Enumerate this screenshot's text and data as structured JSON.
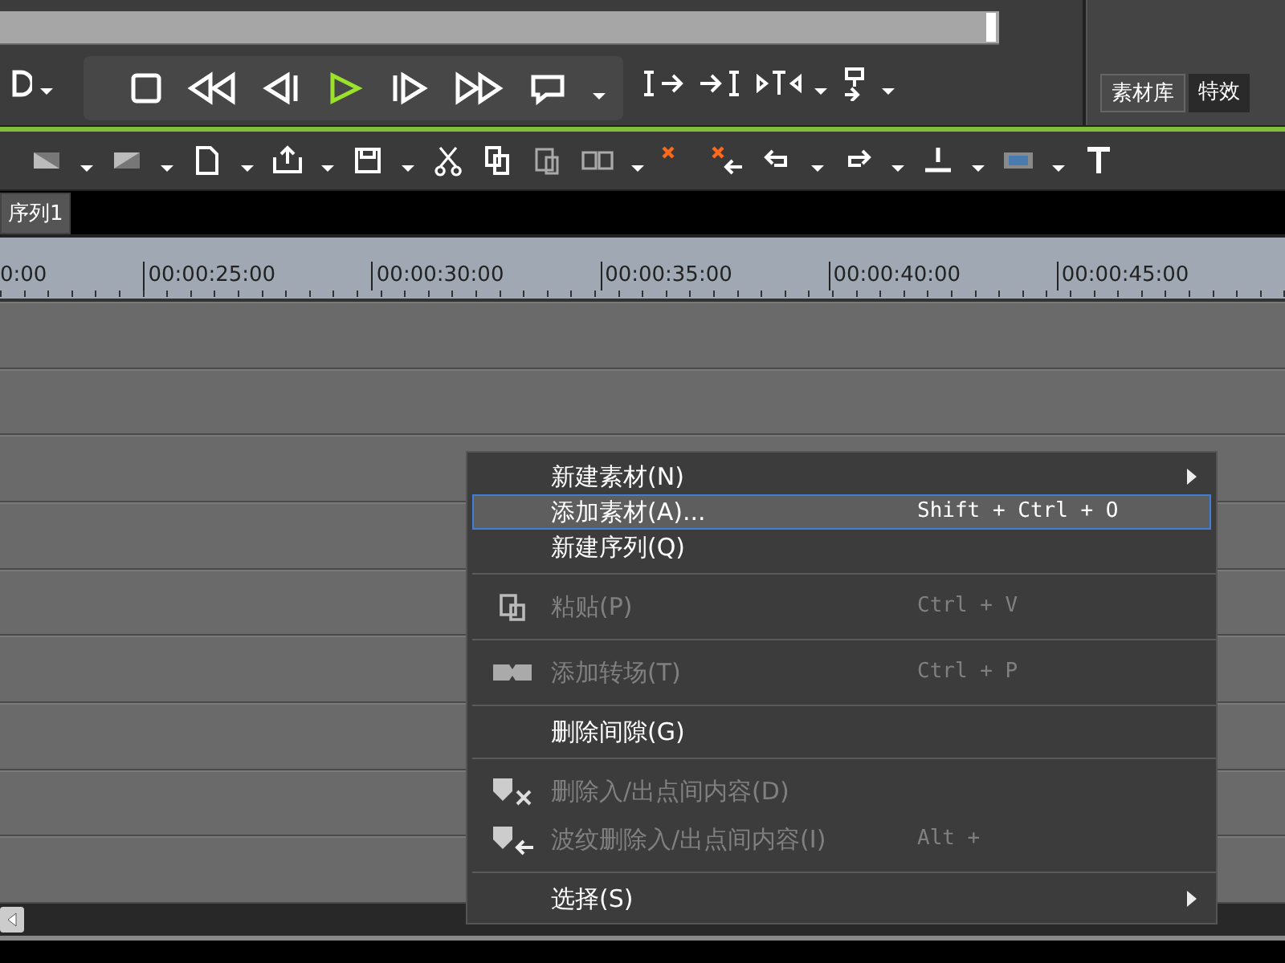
{
  "library_tabs": [
    {
      "label": "素材库",
      "selected": true
    },
    {
      "label": "特效",
      "selected": false
    }
  ],
  "sequence_tab": {
    "label": "序列1",
    "selected": true
  },
  "ruler": {
    "labels": [
      "0:00",
      "00:00:25:00",
      "00:00:30:00",
      "00:00:35:00",
      "00:00:40:00",
      "00:00:45:00"
    ]
  },
  "context_menu": {
    "items": [
      {
        "kind": "item",
        "label": "新建素材(N)",
        "submenu": true,
        "disabled": false,
        "selected": false
      },
      {
        "kind": "item",
        "label": "添加素材(A)...",
        "shortcut": "Shift + Ctrl + O",
        "submenu": false,
        "disabled": false,
        "selected": true
      },
      {
        "kind": "item",
        "label": "新建序列(Q)",
        "submenu": false,
        "disabled": false,
        "selected": false
      },
      {
        "kind": "separator"
      },
      {
        "kind": "paste",
        "label": "粘贴(P)",
        "shortcut": "Ctrl + V",
        "submenu": false,
        "disabled": true,
        "selected": false
      },
      {
        "kind": "separator"
      },
      {
        "kind": "transition",
        "label": "添加转场(T)",
        "shortcut": "Ctrl + P",
        "submenu": false,
        "disabled": true,
        "selected": false
      },
      {
        "kind": "separator"
      },
      {
        "kind": "item",
        "label": "删除间隙(G)",
        "submenu": false,
        "disabled": false,
        "selected": false
      },
      {
        "kind": "separator"
      },
      {
        "kind": "delete",
        "label": "删除入/出点间内容(D)",
        "submenu": false,
        "disabled": true,
        "selected": false
      },
      {
        "kind": "ripple",
        "label": "波纹删除入/出点间内容(I)",
        "shortcut": "Alt +",
        "submenu": false,
        "disabled": true,
        "selected": false
      },
      {
        "kind": "separator"
      },
      {
        "kind": "item",
        "label": "选择(S)",
        "submenu": true,
        "disabled": false,
        "selected": false
      }
    ]
  }
}
